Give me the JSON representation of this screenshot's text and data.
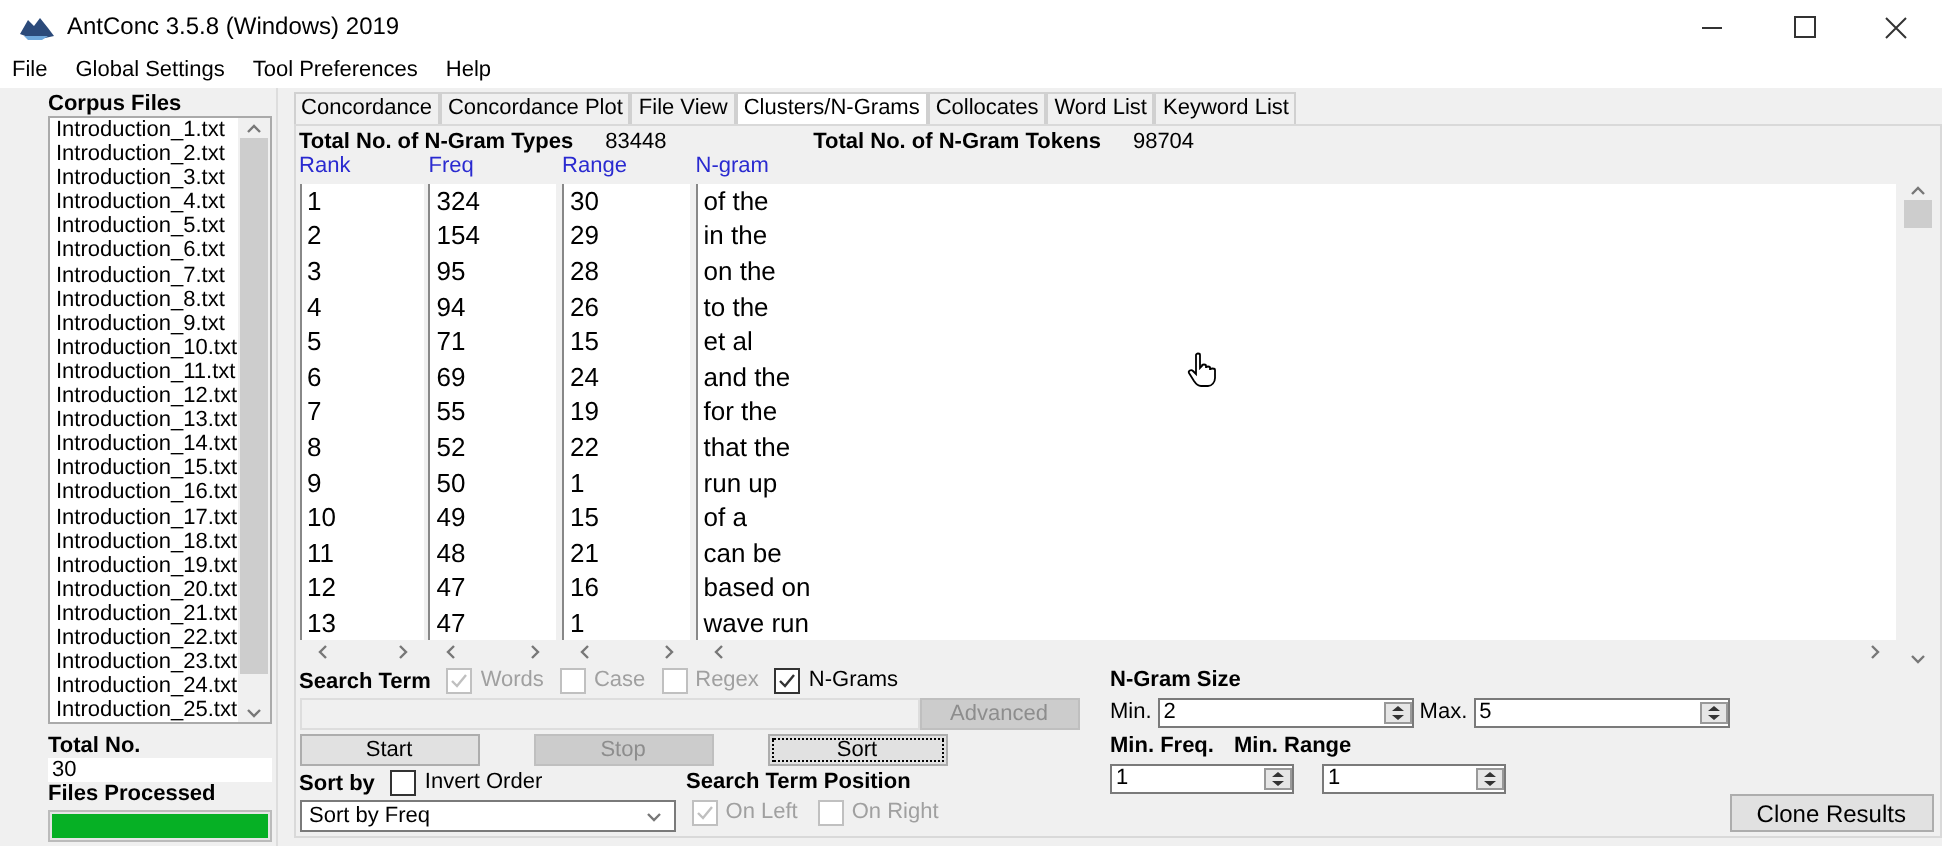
{
  "window": {
    "title": "AntConc 3.5.8 (Windows) 2019"
  },
  "menu": [
    "File",
    "Global Settings",
    "Tool Preferences",
    "Help"
  ],
  "corpus": {
    "label": "Corpus Files",
    "files": [
      "Introduction_1.txt",
      "Introduction_2.txt",
      "Introduction_3.txt",
      "Introduction_4.txt",
      "Introduction_5.txt",
      "Introduction_6.txt",
      "Introduction_7.txt",
      "Introduction_8.txt",
      "Introduction_9.txt",
      "Introduction_10.txt",
      "Introduction_11.txt",
      "Introduction_12.txt",
      "Introduction_13.txt",
      "Introduction_14.txt",
      "Introduction_15.txt",
      "Introduction_16.txt",
      "Introduction_17.txt",
      "Introduction_18.txt",
      "Introduction_19.txt",
      "Introduction_20.txt",
      "Introduction_21.txt",
      "Introduction_22.txt",
      "Introduction_23.txt",
      "Introduction_24.txt",
      "Introduction_25.txt"
    ],
    "total_label": "Total No.",
    "total": "30",
    "processed_label": "Files Processed",
    "level": 1
  },
  "tabs": [
    {
      "label": "Concordance",
      "selected": false
    },
    {
      "label": "Concordance Plot",
      "selected": false
    },
    {
      "label": "File View",
      "selected": false
    },
    {
      "label": "Clusters/N-Grams",
      "selected": true
    },
    {
      "label": "Collocates",
      "selected": false
    },
    {
      "label": "Word List",
      "selected": false
    },
    {
      "label": "Keyword List",
      "selected": false
    }
  ],
  "totals": [
    {
      "label": "Total No. of N-Gram Types",
      "value": "83448"
    },
    {
      "label": "Total No. of N-Gram Tokens",
      "value": "98704"
    }
  ],
  "table": {
    "columns": [
      "Rank",
      "Freq",
      "Range",
      "N-gram"
    ],
    "rows": [
      [
        "1",
        "324",
        "30",
        "of the"
      ],
      [
        "2",
        "154",
        "29",
        "in the"
      ],
      [
        "3",
        "95",
        "28",
        "on the"
      ],
      [
        "4",
        "94",
        "26",
        "to the"
      ],
      [
        "5",
        "71",
        "15",
        "et al"
      ],
      [
        "6",
        "69",
        "24",
        "and the"
      ],
      [
        "7",
        "55",
        "19",
        "for the"
      ],
      [
        "8",
        "52",
        "22",
        "that the"
      ],
      [
        "9",
        "50",
        "1",
        "run up"
      ],
      [
        "10",
        "49",
        "15",
        "of a"
      ],
      [
        "11",
        "48",
        "21",
        "can be"
      ],
      [
        "12",
        "47",
        "16",
        "based on"
      ],
      [
        "13",
        "47",
        "1",
        "wave run"
      ]
    ]
  },
  "search": {
    "label": "Search Term",
    "options": [
      {
        "label": "Words",
        "checked": true,
        "disabled": true
      },
      {
        "label": "Case",
        "checked": false,
        "disabled": true
      },
      {
        "label": "Regex",
        "checked": false,
        "disabled": true
      },
      {
        "label": "N-Grams",
        "checked": true,
        "disabled": false
      }
    ],
    "advanced": {
      "label": "Advanced",
      "disabled": true
    }
  },
  "buttons": [
    {
      "label": "Start",
      "disabled": false,
      "focused": false
    },
    {
      "label": "Stop",
      "disabled": true,
      "focused": false
    },
    {
      "label": "Sort",
      "disabled": false,
      "focused": true
    }
  ],
  "sort": {
    "label": "Sort by",
    "invert": {
      "label": "Invert Order",
      "checked": false,
      "disabled": false
    },
    "value": "Sort by Freq"
  },
  "position": {
    "label": "Search Term Position",
    "options": [
      {
        "label": "On Left",
        "checked": true,
        "disabled": true
      },
      {
        "label": "On Right",
        "checked": false,
        "disabled": true
      }
    ]
  },
  "ngram_size": {
    "label": "N-Gram Size",
    "min_label": "Min.",
    "min": "2",
    "max_label": "Max.",
    "max": "5"
  },
  "min_freq": {
    "label": "Min. Freq.",
    "value": "1"
  },
  "min_range": {
    "label": "Min. Range",
    "value": "1"
  },
  "clone_button": "Clone Results"
}
